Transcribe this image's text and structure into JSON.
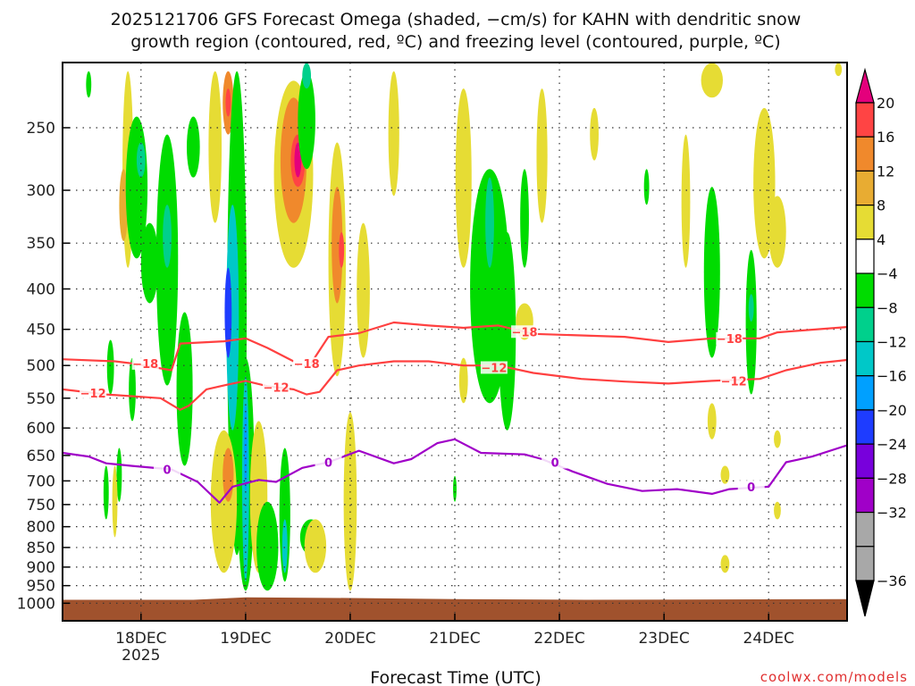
{
  "chart_data": {
    "type": "heatmap",
    "title_line1": "2025121706 GFS Forecast Omega (shaded, −cm/s) for KAHN with dendritic snow",
    "title_line2": "growth region (contoured, red, ºC) and freezing level (contoured, purple, ºC)",
    "xlabel": "Forecast Time (UTC)",
    "ylabel": "",
    "credit": "coolwx.com/models",
    "x_units": "hours since 2025-12-17 06Z",
    "xlim": [
      0,
      180
    ],
    "ylim_hPa": [
      1052,
      207
    ],
    "y_scale": "log",
    "y_ticks": [
      "250",
      "300",
      "350",
      "400",
      "450",
      "500",
      "550",
      "600",
      "650",
      "700",
      "750",
      "800",
      "850",
      "900",
      "950",
      "1000"
    ],
    "y_tick_values": [
      250,
      300,
      350,
      400,
      450,
      500,
      550,
      600,
      650,
      700,
      750,
      800,
      850,
      900,
      950,
      1000
    ],
    "x_ticks": [
      {
        "hour": 18,
        "label": "18DEC",
        "sub": "2025"
      },
      {
        "hour": 42,
        "label": "19DEC",
        "sub": ""
      },
      {
        "hour": 66,
        "label": "20DEC",
        "sub": ""
      },
      {
        "hour": 90,
        "label": "21DEC",
        "sub": ""
      },
      {
        "hour": 114,
        "label": "22DEC",
        "sub": ""
      },
      {
        "hour": 138,
        "label": "23DEC",
        "sub": ""
      },
      {
        "hour": 162,
        "label": "24DEC",
        "sub": ""
      }
    ],
    "grid": true,
    "colorbar": {
      "labels": [
        "20",
        "16",
        "12",
        "8",
        "4",
        "−4",
        "−8",
        "−12",
        "−16",
        "−20",
        "−24",
        "−28",
        "−32",
        "−36"
      ],
      "above_color": "#e4007c",
      "box_colors": [
        "#ff4444",
        "#f0892c",
        "#e8ac32",
        "#e6dc34",
        "#ffffff",
        "#00dc00",
        "#00d08c",
        "#00c8c8",
        "#00a0ff",
        "#1e3cff",
        "#7800dc",
        "#a000c8",
        "#a8a8a8"
      ],
      "below_color": "#000000",
      "box_thresholds": [
        16,
        12,
        8,
        4,
        -4,
        -8,
        -12,
        -16,
        -20,
        -24,
        -28,
        -32,
        -36
      ]
    },
    "omega_blobs_fields": [
      "hour",
      "p_top",
      "p_bottom",
      "width_hours",
      "value"
    ],
    "omega_blobs": [
      [
        15,
        212,
        376,
        2.5,
        6
      ],
      [
        14,
        282,
        348,
        2,
        10
      ],
      [
        17,
        242,
        366,
        5,
        -6
      ],
      [
        18,
        261,
        289,
        2,
        -10
      ],
      [
        24,
        255,
        530,
        5,
        -6
      ],
      [
        24,
        313,
        376,
        2,
        -10
      ],
      [
        28,
        428,
        670,
        3.7,
        -6
      ],
      [
        30,
        242,
        289,
        3,
        -6
      ],
      [
        20,
        330,
        417,
        4,
        -6
      ],
      [
        11,
        464,
        544,
        1.6,
        -6
      ],
      [
        16,
        489,
        588,
        1.6,
        -6
      ],
      [
        10,
        670,
        783,
        1.2,
        -6
      ],
      [
        13,
        636,
        744,
        1.2,
        -6
      ],
      [
        12,
        670,
        825,
        1.2,
        5
      ],
      [
        35,
        212,
        330,
        3,
        5
      ],
      [
        38,
        212,
        255,
        2.5,
        12
      ],
      [
        38,
        223,
        242,
        1.2,
        18
      ],
      [
        40,
        212,
        869,
        4.5,
        -6
      ],
      [
        39,
        313,
        604,
        2.9,
        -14
      ],
      [
        38,
        376,
        489,
        1.6,
        -22
      ],
      [
        37,
        604,
        915,
        6,
        6
      ],
      [
        38,
        636,
        744,
        2.5,
        12
      ],
      [
        42,
        489,
        964,
        4,
        -6
      ],
      [
        42,
        516,
        939,
        1.6,
        -14
      ],
      [
        42,
        558,
        724,
        0.8,
        -20
      ],
      [
        45,
        588,
        915,
        4,
        5
      ],
      [
        47,
        744,
        964,
        5,
        -6
      ],
      [
        53,
        218,
        376,
        9,
        5
      ],
      [
        53,
        229,
        330,
        6,
        12
      ],
      [
        54,
        255,
        297,
        3.3,
        18
      ],
      [
        54,
        261,
        289,
        1.6,
        22
      ],
      [
        56,
        212,
        282,
        4,
        -6
      ],
      [
        56,
        207,
        223,
        2,
        -10
      ],
      [
        63,
        261,
        516,
        4,
        5
      ],
      [
        63,
        297,
        417,
        2.5,
        12
      ],
      [
        64,
        339,
        376,
        1.2,
        17
      ],
      [
        66,
        573,
        964,
        3,
        5
      ],
      [
        51,
        636,
        939,
        2.5,
        -6
      ],
      [
        51,
        783,
        915,
        1.2,
        -16
      ],
      [
        57,
        783,
        869,
        5,
        -6
      ],
      [
        58,
        783,
        915,
        5,
        5
      ],
      [
        69,
        330,
        489,
        3,
        5
      ],
      [
        76,
        212,
        305,
        2.5,
        5
      ],
      [
        98,
        282,
        558,
        9,
        -6
      ],
      [
        98,
        289,
        376,
        2,
        -10
      ],
      [
        92,
        223,
        376,
        3.7,
        5
      ],
      [
        102,
        339,
        604,
        4,
        -6
      ],
      [
        92,
        489,
        558,
        2,
        5
      ],
      [
        106,
        282,
        376,
        2,
        -6
      ],
      [
        106,
        417,
        464,
        4,
        5
      ],
      [
        110,
        223,
        330,
        2.5,
        5
      ],
      [
        122,
        236,
        275,
        2,
        5
      ],
      [
        134,
        282,
        313,
        1.2,
        -6
      ],
      [
        143,
        255,
        376,
        2,
        5
      ],
      [
        149,
        297,
        489,
        3.7,
        -6
      ],
      [
        149,
        207,
        229,
        5,
        5
      ],
      [
        161,
        236,
        366,
        5,
        6
      ],
      [
        158,
        357,
        544,
        2.5,
        -6
      ],
      [
        158,
        406,
        440,
        1.2,
        -10
      ],
      [
        164,
        305,
        376,
        4,
        5
      ],
      [
        149,
        558,
        620,
        2,
        5
      ],
      [
        152,
        670,
        706,
        2,
        5
      ],
      [
        152,
        869,
        915,
        2,
        5
      ],
      [
        164,
        604,
        636,
        1.6,
        5
      ],
      [
        164,
        744,
        783,
        1.6,
        5
      ],
      [
        178,
        207,
        215,
        1.6,
        5
      ],
      [
        90,
        690,
        744,
        0.8,
        -6
      ],
      [
        6,
        212,
        229,
        1.2,
        -6
      ]
    ],
    "surface_pressure": [
      [
        0,
        990
      ],
      [
        30,
        990
      ],
      [
        42,
        983
      ],
      [
        66,
        985
      ],
      [
        90,
        988
      ],
      [
        120,
        990
      ],
      [
        180,
        988
      ]
    ],
    "contours": [
      {
        "name": "-18",
        "color": "#ff4040",
        "segments": [
          [
            [
              0,
              491
            ],
            [
              12,
              494
            ],
            [
              16,
              497
            ],
            [
              25,
              507
            ],
            [
              27,
              469
            ],
            [
              37,
              466
            ],
            [
              42,
              462
            ],
            [
              47,
              475
            ],
            [
              53,
              494
            ]
          ],
          [
            [
              57,
              497
            ],
            [
              61,
              460
            ],
            [
              68,
              455
            ],
            [
              76,
              441
            ],
            [
              84,
              445
            ],
            [
              92,
              448
            ],
            [
              100,
              445
            ],
            [
              108,
              456
            ],
            [
              129,
              460
            ],
            [
              139,
              467
            ],
            [
              149,
              462
            ],
            [
              160,
              462
            ],
            [
              164,
              454
            ],
            [
              180,
              447
            ]
          ]
        ],
        "labels": [
          [
            19,
            497
          ],
          [
            56,
            497
          ],
          [
            106,
            453
          ],
          [
            153,
            462
          ]
        ]
      },
      {
        "name": "-12",
        "color": "#ff4040",
        "segments": [
          [
            [
              0,
              536
            ],
            [
              10,
              544
            ],
            [
              22.5,
              550
            ],
            [
              27,
              569
            ],
            [
              29,
              562
            ],
            [
              33,
              536
            ],
            [
              39,
              527
            ],
            [
              42,
              523
            ],
            [
              47,
              531
            ],
            [
              53,
              536
            ],
            [
              56,
              544
            ],
            [
              59,
              540
            ],
            [
              63,
              507
            ],
            [
              68,
              500
            ],
            [
              76,
              494
            ],
            [
              84,
              494
            ],
            [
              92,
              500
            ],
            [
              100,
              500
            ],
            [
              108,
              511
            ],
            [
              119,
              520
            ],
            [
              129,
              524
            ],
            [
              139,
              527
            ],
            [
              149,
              523
            ],
            [
              160,
              520
            ],
            [
              166,
              507
            ],
            [
              174,
              496
            ],
            [
              180,
              492
            ]
          ]
        ],
        "labels": [
          [
            7,
            542
          ],
          [
            49,
            533
          ],
          [
            99,
            503
          ],
          [
            154,
            523
          ]
        ]
      },
      {
        "name": "0",
        "color": "#a000c8",
        "segments": [
          [
            [
              0,
              645
            ],
            [
              6,
              652
            ],
            [
              10,
              665
            ],
            [
              16,
              670
            ],
            [
              25,
              677
            ],
            [
              31,
              702
            ],
            [
              36,
              746
            ],
            [
              39,
              712
            ],
            [
              45,
              698
            ],
            [
              49,
              702
            ],
            [
              55,
              674
            ],
            [
              61,
              663
            ],
            [
              68,
              641
            ],
            [
              76,
              665
            ],
            [
              80,
              657
            ],
            [
              86,
              627
            ],
            [
              90,
              620
            ],
            [
              96,
              645
            ],
            [
              106,
              648
            ],
            [
              110,
              657
            ],
            [
              117,
              681
            ],
            [
              125,
              706
            ],
            [
              133,
              721
            ],
            [
              141,
              717
            ],
            [
              149,
              727
            ],
            [
              153,
              717
            ],
            [
              162,
              712
            ],
            [
              166,
              663
            ],
            [
              172,
              652
            ],
            [
              180,
              631
            ]
          ]
        ],
        "labels": [
          [
            24,
            677
          ],
          [
            61,
            663
          ],
          [
            113,
            663
          ],
          [
            158,
            712
          ]
        ]
      }
    ],
    "contour_label_texts": {
      "-18": "−18",
      "-12": "−12",
      "0": "0"
    }
  }
}
